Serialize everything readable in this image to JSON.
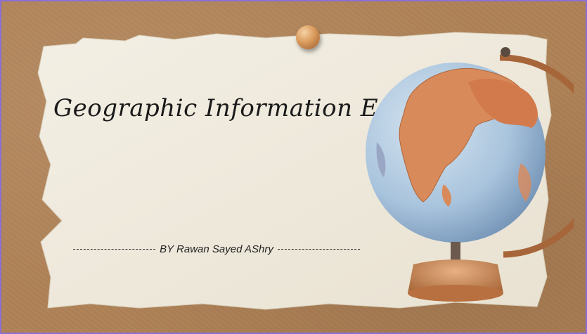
{
  "slide": {
    "title": "Geographic Information Expert",
    "byline": "BY Rawan Sayed AShry"
  },
  "colors": {
    "border": "#8b6fd6",
    "board": "#b08358",
    "paper": "#f1ece0",
    "pin": "#d99a5c",
    "ocean": "#a9c4dd",
    "land": "#d98a5a"
  },
  "icons": {
    "pin": "push-pin-icon",
    "globe": "globe-icon"
  }
}
